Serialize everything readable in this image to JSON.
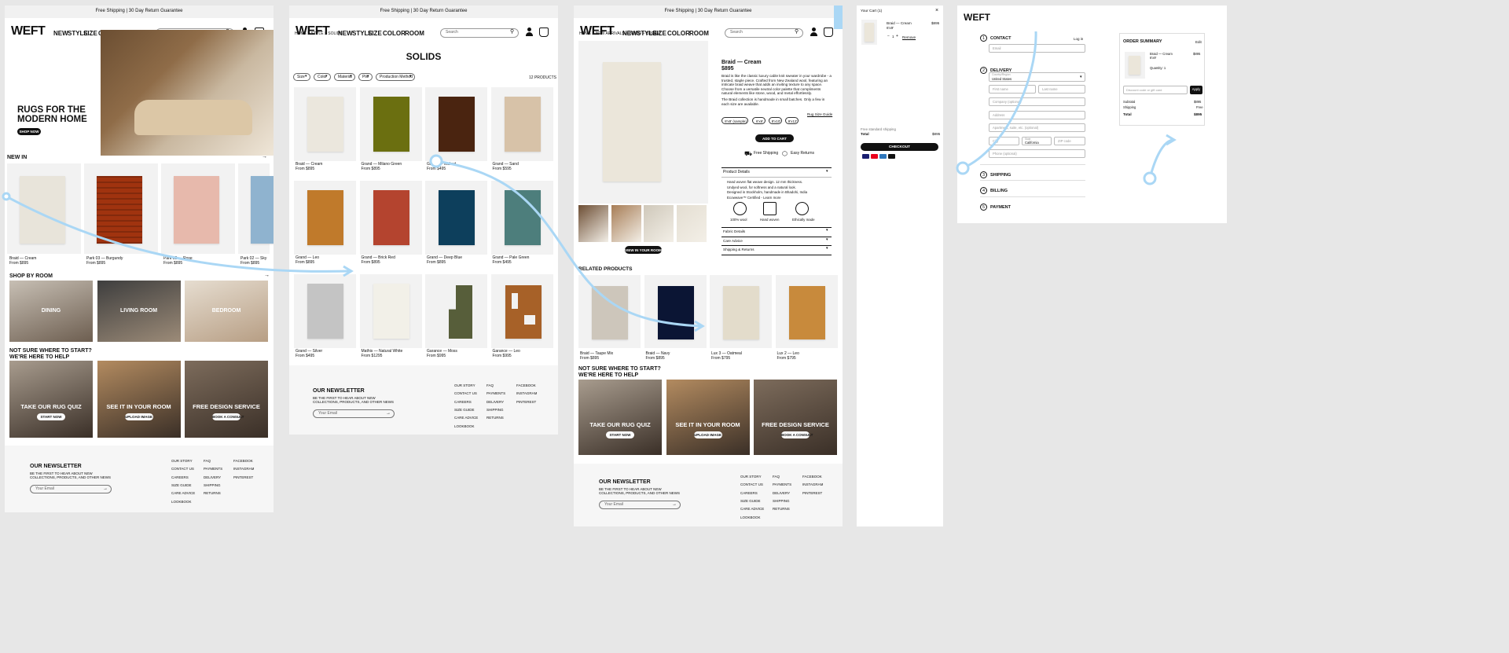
{
  "shipping_banner": "Free Shipping | 30 Day Return Guarantee",
  "brand": "WEFT",
  "nav": [
    "NEW",
    "STYLE",
    "SIZE",
    "COLOR",
    "ROOM"
  ],
  "search_placeholder": "Search",
  "colors": {
    "accent_line": "#aad7f5",
    "dark": "#1a1a1a",
    "canvas": "#e7e7e7",
    "highlight_box": "#aad7f5"
  },
  "home": {
    "hero_title": "RUGS FOR THE\nMODERN HOME",
    "hero_cta": "SHOP NOW",
    "new_in": "NEW IN",
    "products": [
      {
        "name": "Braid — Cream",
        "price": "From $895",
        "color": "#e8e4da",
        "bg": "#f2f2f2"
      },
      {
        "name": "Park 03 — Burgundy",
        "price": "From $895",
        "color": "#a0330f",
        "bg": "#f2f2f2"
      },
      {
        "name": "Park 02 — Rose",
        "price": "From $895",
        "color": "#e7b9ac",
        "bg": "#f2f2f2"
      },
      {
        "name": "Park 02 — Sky",
        "price": "From $895",
        "color": "#8fb3cf",
        "bg": "#f2f2f2"
      }
    ],
    "shop_by_room": "SHOP BY ROOM",
    "rooms": [
      "DINING",
      "LIVING ROOM",
      "BEDROOM"
    ],
    "help_title": "NOT SURE WHERE TO START?\nWE'RE HERE TO HELP",
    "help": [
      {
        "title": "TAKE OUR RUG QUIZ",
        "cta": "START NOW",
        "color": "#a89c8e"
      },
      {
        "title": "SEE IT IN YOUR ROOM",
        "cta": "UPLOAD IMAGE",
        "color": "#b38b60"
      },
      {
        "title": "FREE DESIGN SERVICE",
        "cta": "BOOK A CONSULT",
        "color": "#7d6c5c"
      }
    ]
  },
  "footer": {
    "newsletter_title": "OUR NEWSLETTER",
    "newsletter_text": "BE THE FIRST TO HEAR ABOUT NEW\nCOLLECTIONS, PRODUCTS, AND OTHER NEWS",
    "email_placeholder": "Your Email",
    "col1": [
      "OUR STORY",
      "CONTACT US",
      "CAREERS",
      "SIZE GUIDE",
      "CARE ADVICE",
      "LOOKBOOK"
    ],
    "col2": [
      "FAQ",
      "PAYMENTS",
      "DELIVERY",
      "SHIPPING",
      "RETURNS"
    ],
    "col3": [
      "FACEBOOK",
      "INSTAGRAM",
      "PINTEREST"
    ]
  },
  "plp": {
    "breadcrumb": "HOME > STYLE > SOLIDS",
    "title": "SOLIDS",
    "filters": [
      "Size",
      "Color",
      "Material",
      "Pile",
      "Production Method"
    ],
    "count": "12 PRODUCTS",
    "products": [
      {
        "name": "Braid — Cream",
        "price": "From $895",
        "color": "#ebe7dd"
      },
      {
        "name": "Grand — Milano Green",
        "price": "From $895",
        "color": "#6b6f10"
      },
      {
        "name": "Grand — Walnut",
        "price": "From $495",
        "color": "#4a2410"
      },
      {
        "name": "Grand — Sand",
        "price": "From $595",
        "color": "#d7c2a8"
      },
      {
        "name": "Grand — Leo",
        "price": "From $895",
        "color": "#c07a2b"
      },
      {
        "name": "Grand — Brick Red",
        "price": "From $895",
        "color": "#b4442f"
      },
      {
        "name": "Grand — Deep Blue",
        "price": "From $895",
        "color": "#0d3f5c"
      },
      {
        "name": "Grand — Pale Green",
        "price": "From $495",
        "color": "#4d7e7c"
      },
      {
        "name": "Grand — Silver",
        "price": "From $495",
        "color": "#c4c4c4"
      },
      {
        "name": "Mathis — Natural White",
        "price": "From $1295",
        "color": "#f2f0e8"
      },
      {
        "name": "Garance — Moss",
        "price": "From $995",
        "color": "#575e3a"
      },
      {
        "name": "Garance — Leo",
        "price": "From $995",
        "color": "#a76128"
      }
    ]
  },
  "pdp": {
    "breadcrumb": "HOME > NEW ARRIVALS > BRAID > CREAM",
    "title": "Braid — Cream",
    "price": "$895",
    "description": "Braid is like the classic luxury cable knit sweater in your wardrobe - a trusted, staple piece. Crafted from New Zealand wool, featuring an intricate braid weave that adds an inviting texture to any space. Choose from a versatile neutral color palette that compliments natural elements like stone, wood, and metal effortlessly.",
    "description2": "The Braid collection is handmade in small batches. Only a few in each size are available.",
    "size_guide": "Rug Size Guide",
    "sizes": [
      "8'x8' (sample)",
      "6'x9'",
      "8'x10'",
      "9'x12'"
    ],
    "add_to_cart": "ADD TO CART",
    "free_shipping": "Free Shipping",
    "easy_returns": "Easy Returns",
    "product_details": "Product Details",
    "bullets": [
      "Hand woven flat weave design. 12 mm thickness.",
      "Undyed wool, for softness and a natural look.",
      "Designed in Stockholm, handmade in Bhadohi, India",
      "Ecoweave™ Certified  -  Learn more"
    ],
    "badges": [
      "100% wool",
      "Hand woven",
      "Ethically made"
    ],
    "accordions": [
      "Fabric Details",
      "Care Advice",
      "Shipping & Returns"
    ],
    "view_in_room": "VIEW IN YOUR ROOM",
    "related_title": "RELATED PRODUCTS",
    "related": [
      {
        "name": "Braid — Taupe Mix",
        "price": "From $895",
        "color": "#cdc6bb"
      },
      {
        "name": "Braid — Navy",
        "price": "From $895",
        "color": "#0b1534"
      },
      {
        "name": "Lux 3 — Oatmeal",
        "price": "From $795",
        "color": "#e3dccb"
      },
      {
        "name": "Lux 2 — Leo",
        "price": "From $795",
        "color": "#c88a3c"
      }
    ]
  },
  "cart": {
    "title": "Your Cart (1)",
    "item_name": "Braid — Cream",
    "item_size": "6'x9'",
    "item_price": "$895",
    "qty": "1",
    "remove": "Remove",
    "shipping_note": "Free standard shipping",
    "total_label": "Total",
    "total": "$895",
    "checkout": "CHECKOUT"
  },
  "checkout": {
    "steps": [
      {
        "num": "1",
        "label": "CONTACT"
      },
      {
        "num": "2",
        "label": "DELIVERY"
      },
      {
        "num": "3",
        "label": "SHIPPING"
      },
      {
        "num": "4",
        "label": "BILLING"
      },
      {
        "num": "5",
        "label": "PAYMENT"
      }
    ],
    "login": "Log in",
    "email_placeholder": "Email",
    "country_label": "Country/Region",
    "country": "United States",
    "first_name": "First name",
    "last_name": "Last name",
    "company": "Company (optional)",
    "address": "Address",
    "apartment": "Apartment, suite, etc. (optional)",
    "city": "City",
    "state_label": "State",
    "state": "California",
    "zip": "ZIP code",
    "phone": "Phone (optional)",
    "summary_title": "ORDER SUMMARY",
    "edit": "Edit",
    "item_name": "Braid — Cream",
    "item_size": "6'x9'",
    "item_price": "$895",
    "quantity": "Quantity: 1",
    "discount_placeholder": "Discount code or gift card",
    "apply": "Apply",
    "subtotal_label": "Subtotal",
    "subtotal": "$895",
    "shipping_label": "Shipping",
    "shipping": "Free",
    "total_label": "Total",
    "total": "$895"
  }
}
